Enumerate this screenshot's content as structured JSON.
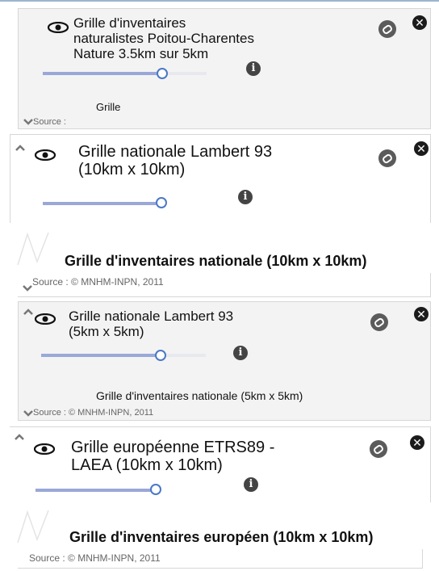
{
  "layers": [
    {
      "title": "Grille d'inventaires naturalistes Poitou-Charentes Nature 3.5km sur 5km",
      "title_lines": [
        "Grille d'inventaires",
        "naturalistes Poitou-Charentes",
        "Nature 3.5km sur 5km"
      ],
      "legend": "Grille",
      "source": "Source :",
      "opacity": 0.8
    },
    {
      "title_lines": [
        "Grille nationale Lambert 93",
        "(10km x 10km)"
      ],
      "legend": "Grille d'inventaires nationale (10km x 10km)",
      "source": "Source : © MNHM-INPN, 2011",
      "opacity": 1.0
    },
    {
      "title_lines": [
        "Grille nationale Lambert 93",
        "(5km x 5km)"
      ],
      "legend": "Grille d'inventaires nationale (5km x 5km)",
      "source": "Source : © MNHM-INPN, 2011",
      "opacity": 0.76
    },
    {
      "title_lines": [
        "Grille européenne ETRS89 -",
        "LAEA (10km x 10km)"
      ],
      "legend": "Grille d'inventaires européen (10km x 10km)",
      "source": "Source : © MNHM-INPN, 2011",
      "opacity": 1.0
    }
  ],
  "icons": {
    "visibility": "eye-icon",
    "metadata_link": "link-icon",
    "remove": "close-icon",
    "info": "info-icon",
    "expand": "caret-icon"
  },
  "glyphs": {
    "close": "✕",
    "info": "i"
  },
  "colors": {
    "slider_fill": "#9aa8d8",
    "knob_border": "#4b78c6",
    "card_bg": "#f3f3f3"
  }
}
